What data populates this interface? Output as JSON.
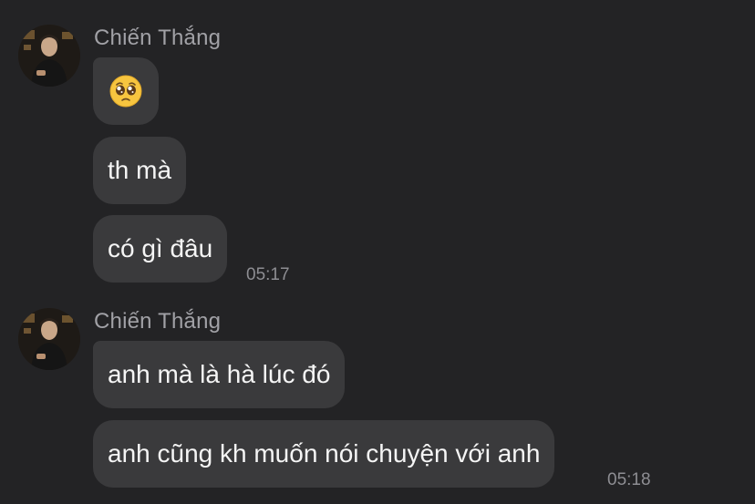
{
  "conversation": {
    "groups": [
      {
        "sender": "Chiến Thắng",
        "avatar_icon": "profile-photo",
        "messages": [
          {
            "type": "emoji",
            "icon": "pleading-face-emoji",
            "text": "🥺"
          },
          {
            "type": "text",
            "text": "th mà"
          },
          {
            "type": "text",
            "text": "có gì đâu"
          }
        ],
        "time": "05:17"
      },
      {
        "sender": "Chiến Thắng",
        "avatar_icon": "profile-photo",
        "messages": [
          {
            "type": "text",
            "text": "anh mà là hà lúc đó"
          },
          {
            "type": "text",
            "text": "anh cũng kh muốn nói chuyện với anh"
          }
        ],
        "time": "05:18"
      }
    ]
  },
  "colors": {
    "background": "#232325",
    "bubble": "#3a3a3c",
    "sender_text": "#a1a1a6",
    "timestamp_text": "#8e8e93"
  }
}
